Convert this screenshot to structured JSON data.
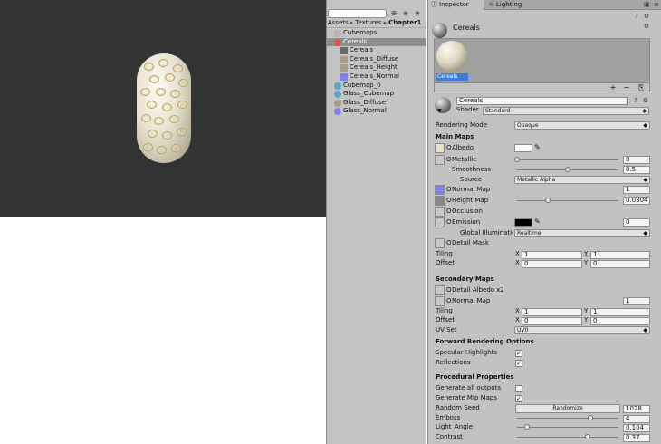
{
  "colors": {
    "viewport_bg": "#333333",
    "panel_bg": "#c2c2c2",
    "selection": "#3d7fd8",
    "normal_map_swatch": "#8080f0",
    "emission_color": "#000000",
    "albedo_color": "#ffffff"
  },
  "project": {
    "breadcrumb": [
      "Assets",
      "Textures",
      "Chapter1"
    ],
    "toolbar_icons": [
      "lock-icon",
      "tag-icon",
      "star-icon"
    ],
    "assets": [
      {
        "label": "Cubemaps",
        "icon": "folder-icon",
        "selected": false,
        "sub": false
      },
      {
        "label": "Cereals",
        "icon": "substance-icon",
        "selected": true,
        "sub": false,
        "expanded": true
      },
      {
        "label": "Cereals",
        "icon": "material-icon",
        "selected": false,
        "sub": true
      },
      {
        "label": "Cereals_Diffuse",
        "icon": "texture-icon",
        "selected": false,
        "sub": true
      },
      {
        "label": "Cereals_Height",
        "icon": "texture-icon",
        "selected": false,
        "sub": true
      },
      {
        "label": "Cereals_Normal",
        "icon": "normalmap-icon",
        "selected": false,
        "sub": true
      },
      {
        "label": "Cubemap_0",
        "icon": "cubemap-icon",
        "selected": false,
        "sub": false
      },
      {
        "label": "Glass_Cubemap",
        "icon": "cubemap-icon",
        "selected": false,
        "sub": false
      },
      {
        "label": "Glass_Diffuse",
        "icon": "texture-icon",
        "selected": false,
        "sub": false
      },
      {
        "label": "Glass_Normal",
        "icon": "normalmap-icon",
        "selected": false,
        "sub": false
      }
    ]
  },
  "inspector": {
    "tabs": {
      "inspector": "Inspector",
      "lighting": "Lighting"
    },
    "header_name": "Cereals",
    "preview_label": "Cereals",
    "preview_buttons": [
      "+",
      "−",
      "⎘"
    ],
    "material_name": "Cereals",
    "shader_label": "Shader",
    "shader_value": "Standard",
    "rendering_mode_label": "Rendering Mode",
    "rendering_mode_value": "Opaque",
    "main_maps": {
      "title": "Main Maps",
      "albedo": "Albedo",
      "metallic": "Metallic",
      "metallic_value": "0",
      "metallic_fraction": 0.0,
      "smoothness": "Smoothness",
      "smoothness_value": "0.5",
      "smoothness_fraction": 0.5,
      "source": "Source",
      "source_value": "Metallic Alpha",
      "normal_map": "Normal Map",
      "normal_map_value": "1",
      "height_map": "Height Map",
      "height_map_value": "0.0304",
      "height_map_fraction": 0.3,
      "occlusion": "Occlusion",
      "emission": "Emission",
      "emission_value": "0",
      "gi_label": "Global Illumination",
      "gi_value": "Realtime",
      "detail_mask": "Detail Mask",
      "tiling": "Tiling",
      "offset": "Offset",
      "tiling_x": "1",
      "tiling_y": "1",
      "offset_x": "0",
      "offset_y": "0",
      "x": "X",
      "y": "Y",
      "dot": "O"
    },
    "secondary_maps": {
      "title": "Secondary Maps",
      "detail_albedo": "Detail Albedo x2",
      "normal_map": "Normal Map",
      "normal_map_value": "1",
      "tiling": "Tiling",
      "offset": "Offset",
      "tiling_x": "1",
      "tiling_y": "1",
      "offset_x": "0",
      "offset_y": "0",
      "uv_set": "UV Set",
      "uv_set_value": "UV0"
    },
    "forward": {
      "title": "Forward Rendering Options",
      "specular": "Specular Highlights",
      "specular_checked": true,
      "reflections": "Reflections",
      "reflections_checked": true
    },
    "procedural": {
      "title": "Procedural Properties",
      "generate_all": "Generate all outputs",
      "generate_all_checked": false,
      "generate_mips": "Generate Mip Maps",
      "generate_mips_checked": true,
      "random_seed": "Random Seed",
      "randomize_button": "Randomize",
      "random_seed_value": "1028",
      "emboss": "Emboss",
      "emboss_value": "4",
      "emboss_fraction": 0.72,
      "light_angle": "Light_Angle",
      "light_angle_value": "0.104",
      "light_angle_fraction": 0.1,
      "contrast": "Contrast",
      "contrast_value": "0.37",
      "contrast_fraction": 0.7
    }
  }
}
